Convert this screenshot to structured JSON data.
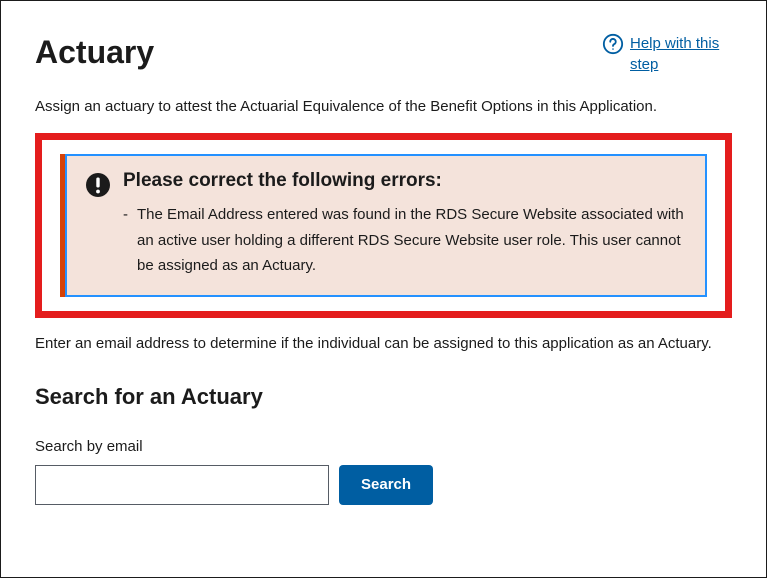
{
  "header": {
    "title": "Actuary",
    "help_link": "Help with this step"
  },
  "intro": "Assign an actuary to attest the Actuarial Equivalence of the Benefit Options in this Application.",
  "alert": {
    "heading": "Please correct the following errors:",
    "errors": [
      "The Email Address entered was found in the RDS Secure Website associated with an active user holding a different RDS Secure Website user role. This user cannot be assigned as an Actuary."
    ]
  },
  "instruction": "Enter an email address to determine if the individual can be assigned to this application as an Actuary.",
  "search": {
    "heading": "Search for an Actuary",
    "label": "Search by email",
    "value": "",
    "button": "Search"
  }
}
